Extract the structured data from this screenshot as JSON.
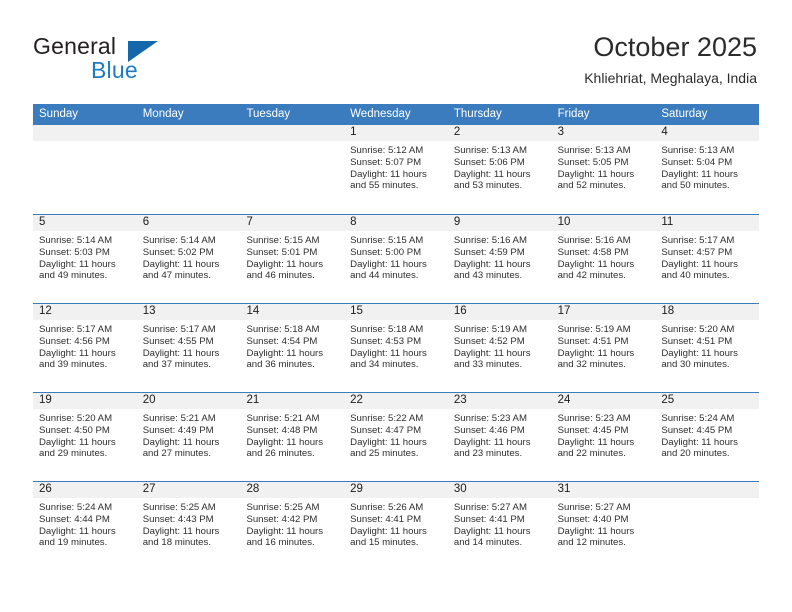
{
  "brand": {
    "name_part1": "General",
    "name_part2": "Blue",
    "triangle_color": "#1567ab",
    "blue_color": "#1f7bc1"
  },
  "header": {
    "title": "October 2025",
    "subtitle": "Khliehriat, Meghalaya, India"
  },
  "theme": {
    "header_blue": "#3a7cbe",
    "daynum_band": "#f1f1f1",
    "text": "#2e2e2e"
  },
  "weekdays": [
    "Sunday",
    "Monday",
    "Tuesday",
    "Wednesday",
    "Thursday",
    "Friday",
    "Saturday"
  ],
  "weeks": [
    [
      {
        "day": "",
        "sunrise": "",
        "sunset": "",
        "daylight_line1": "",
        "daylight_line2": ""
      },
      {
        "day": "",
        "sunrise": "",
        "sunset": "",
        "daylight_line1": "",
        "daylight_line2": ""
      },
      {
        "day": "",
        "sunrise": "",
        "sunset": "",
        "daylight_line1": "",
        "daylight_line2": ""
      },
      {
        "day": "1",
        "sunrise": "Sunrise: 5:12 AM",
        "sunset": "Sunset: 5:07 PM",
        "daylight_line1": "Daylight: 11 hours",
        "daylight_line2": "and 55 minutes."
      },
      {
        "day": "2",
        "sunrise": "Sunrise: 5:13 AM",
        "sunset": "Sunset: 5:06 PM",
        "daylight_line1": "Daylight: 11 hours",
        "daylight_line2": "and 53 minutes."
      },
      {
        "day": "3",
        "sunrise": "Sunrise: 5:13 AM",
        "sunset": "Sunset: 5:05 PM",
        "daylight_line1": "Daylight: 11 hours",
        "daylight_line2": "and 52 minutes."
      },
      {
        "day": "4",
        "sunrise": "Sunrise: 5:13 AM",
        "sunset": "Sunset: 5:04 PM",
        "daylight_line1": "Daylight: 11 hours",
        "daylight_line2": "and 50 minutes."
      }
    ],
    [
      {
        "day": "5",
        "sunrise": "Sunrise: 5:14 AM",
        "sunset": "Sunset: 5:03 PM",
        "daylight_line1": "Daylight: 11 hours",
        "daylight_line2": "and 49 minutes."
      },
      {
        "day": "6",
        "sunrise": "Sunrise: 5:14 AM",
        "sunset": "Sunset: 5:02 PM",
        "daylight_line1": "Daylight: 11 hours",
        "daylight_line2": "and 47 minutes."
      },
      {
        "day": "7",
        "sunrise": "Sunrise: 5:15 AM",
        "sunset": "Sunset: 5:01 PM",
        "daylight_line1": "Daylight: 11 hours",
        "daylight_line2": "and 46 minutes."
      },
      {
        "day": "8",
        "sunrise": "Sunrise: 5:15 AM",
        "sunset": "Sunset: 5:00 PM",
        "daylight_line1": "Daylight: 11 hours",
        "daylight_line2": "and 44 minutes."
      },
      {
        "day": "9",
        "sunrise": "Sunrise: 5:16 AM",
        "sunset": "Sunset: 4:59 PM",
        "daylight_line1": "Daylight: 11 hours",
        "daylight_line2": "and 43 minutes."
      },
      {
        "day": "10",
        "sunrise": "Sunrise: 5:16 AM",
        "sunset": "Sunset: 4:58 PM",
        "daylight_line1": "Daylight: 11 hours",
        "daylight_line2": "and 42 minutes."
      },
      {
        "day": "11",
        "sunrise": "Sunrise: 5:17 AM",
        "sunset": "Sunset: 4:57 PM",
        "daylight_line1": "Daylight: 11 hours",
        "daylight_line2": "and 40 minutes."
      }
    ],
    [
      {
        "day": "12",
        "sunrise": "Sunrise: 5:17 AM",
        "sunset": "Sunset: 4:56 PM",
        "daylight_line1": "Daylight: 11 hours",
        "daylight_line2": "and 39 minutes."
      },
      {
        "day": "13",
        "sunrise": "Sunrise: 5:17 AM",
        "sunset": "Sunset: 4:55 PM",
        "daylight_line1": "Daylight: 11 hours",
        "daylight_line2": "and 37 minutes."
      },
      {
        "day": "14",
        "sunrise": "Sunrise: 5:18 AM",
        "sunset": "Sunset: 4:54 PM",
        "daylight_line1": "Daylight: 11 hours",
        "daylight_line2": "and 36 minutes."
      },
      {
        "day": "15",
        "sunrise": "Sunrise: 5:18 AM",
        "sunset": "Sunset: 4:53 PM",
        "daylight_line1": "Daylight: 11 hours",
        "daylight_line2": "and 34 minutes."
      },
      {
        "day": "16",
        "sunrise": "Sunrise: 5:19 AM",
        "sunset": "Sunset: 4:52 PM",
        "daylight_line1": "Daylight: 11 hours",
        "daylight_line2": "and 33 minutes."
      },
      {
        "day": "17",
        "sunrise": "Sunrise: 5:19 AM",
        "sunset": "Sunset: 4:51 PM",
        "daylight_line1": "Daylight: 11 hours",
        "daylight_line2": "and 32 minutes."
      },
      {
        "day": "18",
        "sunrise": "Sunrise: 5:20 AM",
        "sunset": "Sunset: 4:51 PM",
        "daylight_line1": "Daylight: 11 hours",
        "daylight_line2": "and 30 minutes."
      }
    ],
    [
      {
        "day": "19",
        "sunrise": "Sunrise: 5:20 AM",
        "sunset": "Sunset: 4:50 PM",
        "daylight_line1": "Daylight: 11 hours",
        "daylight_line2": "and 29 minutes."
      },
      {
        "day": "20",
        "sunrise": "Sunrise: 5:21 AM",
        "sunset": "Sunset: 4:49 PM",
        "daylight_line1": "Daylight: 11 hours",
        "daylight_line2": "and 27 minutes."
      },
      {
        "day": "21",
        "sunrise": "Sunrise: 5:21 AM",
        "sunset": "Sunset: 4:48 PM",
        "daylight_line1": "Daylight: 11 hours",
        "daylight_line2": "and 26 minutes."
      },
      {
        "day": "22",
        "sunrise": "Sunrise: 5:22 AM",
        "sunset": "Sunset: 4:47 PM",
        "daylight_line1": "Daylight: 11 hours",
        "daylight_line2": "and 25 minutes."
      },
      {
        "day": "23",
        "sunrise": "Sunrise: 5:23 AM",
        "sunset": "Sunset: 4:46 PM",
        "daylight_line1": "Daylight: 11 hours",
        "daylight_line2": "and 23 minutes."
      },
      {
        "day": "24",
        "sunrise": "Sunrise: 5:23 AM",
        "sunset": "Sunset: 4:45 PM",
        "daylight_line1": "Daylight: 11 hours",
        "daylight_line2": "and 22 minutes."
      },
      {
        "day": "25",
        "sunrise": "Sunrise: 5:24 AM",
        "sunset": "Sunset: 4:45 PM",
        "daylight_line1": "Daylight: 11 hours",
        "daylight_line2": "and 20 minutes."
      }
    ],
    [
      {
        "day": "26",
        "sunrise": "Sunrise: 5:24 AM",
        "sunset": "Sunset: 4:44 PM",
        "daylight_line1": "Daylight: 11 hours",
        "daylight_line2": "and 19 minutes."
      },
      {
        "day": "27",
        "sunrise": "Sunrise: 5:25 AM",
        "sunset": "Sunset: 4:43 PM",
        "daylight_line1": "Daylight: 11 hours",
        "daylight_line2": "and 18 minutes."
      },
      {
        "day": "28",
        "sunrise": "Sunrise: 5:25 AM",
        "sunset": "Sunset: 4:42 PM",
        "daylight_line1": "Daylight: 11 hours",
        "daylight_line2": "and 16 minutes."
      },
      {
        "day": "29",
        "sunrise": "Sunrise: 5:26 AM",
        "sunset": "Sunset: 4:41 PM",
        "daylight_line1": "Daylight: 11 hours",
        "daylight_line2": "and 15 minutes."
      },
      {
        "day": "30",
        "sunrise": "Sunrise: 5:27 AM",
        "sunset": "Sunset: 4:41 PM",
        "daylight_line1": "Daylight: 11 hours",
        "daylight_line2": "and 14 minutes."
      },
      {
        "day": "31",
        "sunrise": "Sunrise: 5:27 AM",
        "sunset": "Sunset: 4:40 PM",
        "daylight_line1": "Daylight: 11 hours",
        "daylight_line2": "and 12 minutes."
      },
      {
        "day": "",
        "sunrise": "",
        "sunset": "",
        "daylight_line1": "",
        "daylight_line2": ""
      }
    ]
  ]
}
